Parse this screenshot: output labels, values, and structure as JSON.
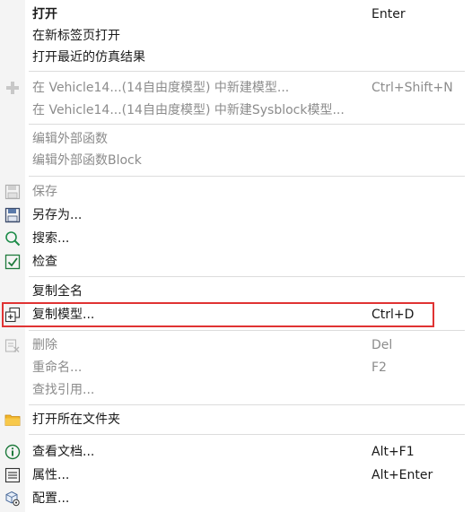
{
  "menu": {
    "open": {
      "label": "打开",
      "shortcut": "Enter"
    },
    "open_new_tab": {
      "label": "在新标签页打开"
    },
    "open_recent": {
      "label": "打开最近的仿真结果"
    },
    "new_model": {
      "label": "在 Vehicle14...(14自由度模型) 中新建模型...",
      "shortcut": "Ctrl+Shift+N"
    },
    "new_sysblock": {
      "label": "在 Vehicle14...(14自由度模型) 中新建Sysblock模型..."
    },
    "edit_ext_func": {
      "label": "编辑外部函数"
    },
    "edit_ext_func_block": {
      "label": "编辑外部函数Block"
    },
    "save": {
      "label": "保存"
    },
    "save_as": {
      "label": "另存为..."
    },
    "search": {
      "label": "搜索..."
    },
    "check": {
      "label": "检查"
    },
    "copy_full_name": {
      "label": "复制全名"
    },
    "copy_model": {
      "label": "复制模型...",
      "shortcut": "Ctrl+D"
    },
    "delete": {
      "label": "删除",
      "shortcut": "Del"
    },
    "rename": {
      "label": "重命名...",
      "shortcut": "F2"
    },
    "find_refs": {
      "label": "查找引用..."
    },
    "open_folder": {
      "label": "打开所在文件夹"
    },
    "view_docs": {
      "label": "查看文档...",
      "shortcut": "Alt+F1"
    },
    "properties": {
      "label": "属性...",
      "shortcut": "Alt+Enter"
    },
    "config": {
      "label": "配置..."
    }
  },
  "colors": {
    "highlight_border": "#e03333",
    "disabled_text": "#8c8c8c",
    "folder": "#f0b429",
    "check": "#1e7a3c",
    "search": "#1e8c4a",
    "info": "#1e7a3c"
  },
  "icons": {
    "new_model": "plus-icon",
    "save": "save-disk-icon",
    "save_as": "save-as-disk-icon",
    "search": "magnifier-icon",
    "check": "checkbox-check-icon",
    "copy_model": "copy-plus-icon",
    "delete": "delete-icon",
    "open_folder": "folder-icon",
    "view_docs": "info-icon",
    "properties": "list-icon",
    "config": "cube-gear-icon"
  }
}
